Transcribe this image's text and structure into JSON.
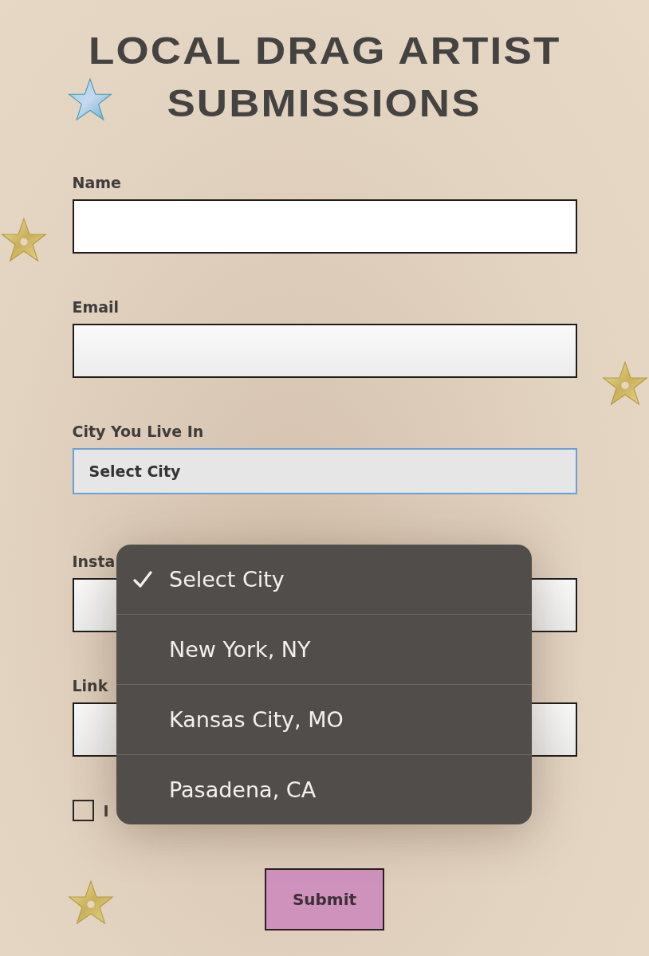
{
  "title_lines": [
    "LOCAL DRAG ARTIST",
    "SUBMISSIONS"
  ],
  "fields": [
    {
      "label": "Name",
      "kind": "text"
    },
    {
      "label": "Email",
      "kind": "text"
    },
    {
      "label": "City You Live In",
      "kind": "select",
      "value": "Select City",
      "focused": true
    },
    {
      "label": "Insta",
      "kind": "text"
    },
    {
      "label": "Link",
      "kind": "text"
    }
  ],
  "checkbox": {
    "label": "I",
    "checked": false
  },
  "submit": "Submit",
  "dropdown": {
    "options": [
      {
        "label": "Select City",
        "selected": true
      },
      {
        "label": "New York, NY",
        "selected": false
      },
      {
        "label": "Kansas City, MO",
        "selected": false
      },
      {
        "label": "Pasadena, CA",
        "selected": false
      }
    ]
  }
}
